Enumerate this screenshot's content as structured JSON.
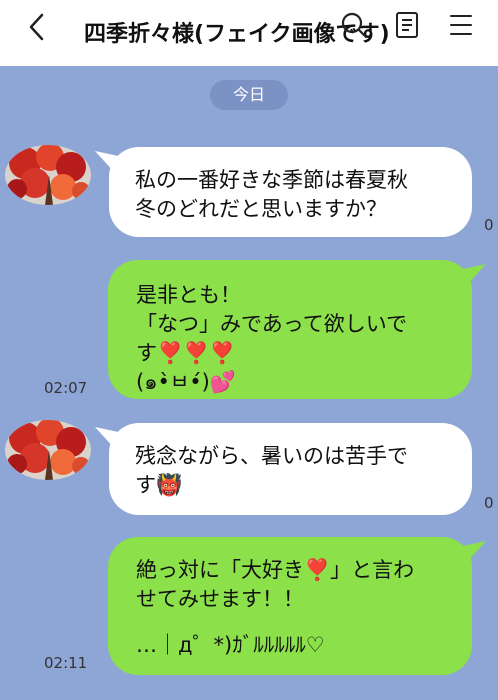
{
  "header": {
    "title": "四季折々様(フェイク画像です)",
    "back_icon": "chevron-left-icon",
    "search_icon": "search-icon",
    "notes_icon": "notes-icon",
    "menu_icon": "hamburger-menu-icon"
  },
  "date_divider": "今日",
  "messages": [
    {
      "direction": "incoming",
      "lines": [
        "私の一番好きな季節は春夏秋",
        "冬のどれだと思いますか？"
      ],
      "time_partial": "0"
    },
    {
      "direction": "outgoing",
      "lines": [
        "是非とも！",
        "「なつ」みであって欲しいで",
        "す❣️❣️❣️",
        "(๑•̀ㅂ•́)💕"
      ],
      "time": "02:07"
    },
    {
      "direction": "incoming",
      "lines": [
        "残念ながら、暑いのは苦手で",
        "す👹"
      ],
      "time_partial": "0"
    },
    {
      "direction": "outgoing",
      "lines": [
        "絶っ対に「大好き❣️」と言わ",
        "せてみせます！！",
        "",
        "…｜д゜*)ｶﾞﾙﾙﾙﾙﾙ♡"
      ],
      "time": "02:11"
    }
  ],
  "colors": {
    "background": "#8ea6d6",
    "outgoing_bubble": "#8ce04a",
    "incoming_bubble": "#ffffff",
    "date_pill": "#7d92c4"
  }
}
